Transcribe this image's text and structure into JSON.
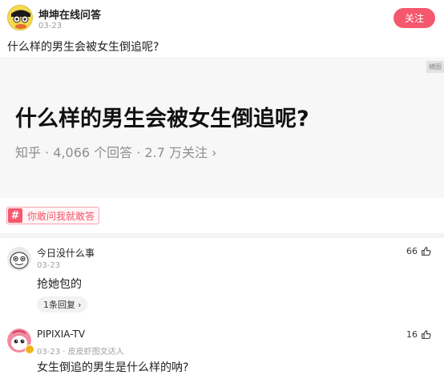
{
  "post": {
    "author": "坤坤在线问答",
    "date": "03-23",
    "follow_label": "关注",
    "title": "什么样的男生会被女生倒追呢?"
  },
  "card": {
    "badge": "横图",
    "title": "什么样的男生会被女生倒追呢?",
    "meta": "知乎 · 4,066 个回答 · 2.7 万关注 ›"
  },
  "topic": {
    "hash": "#",
    "label": "你敢问我就敢答"
  },
  "comments": [
    {
      "name": "今日没什么事",
      "meta": "03-23",
      "text": "抢她包的",
      "likes": "66",
      "reply_label": "1条回复",
      "reply_chevron": "›"
    },
    {
      "name": "PIPIXIA-TV",
      "meta": "03-23 · 皮皮虾图文达人",
      "text": "女生倒追的男生是什么样的呐?",
      "likes": "16"
    }
  ],
  "icons": {
    "like": "thumbs-up-icon",
    "avatar_main": "cartoon-avatar-icon"
  },
  "colors": {
    "accent": "#f5576c",
    "badge": "#f3b31c"
  }
}
